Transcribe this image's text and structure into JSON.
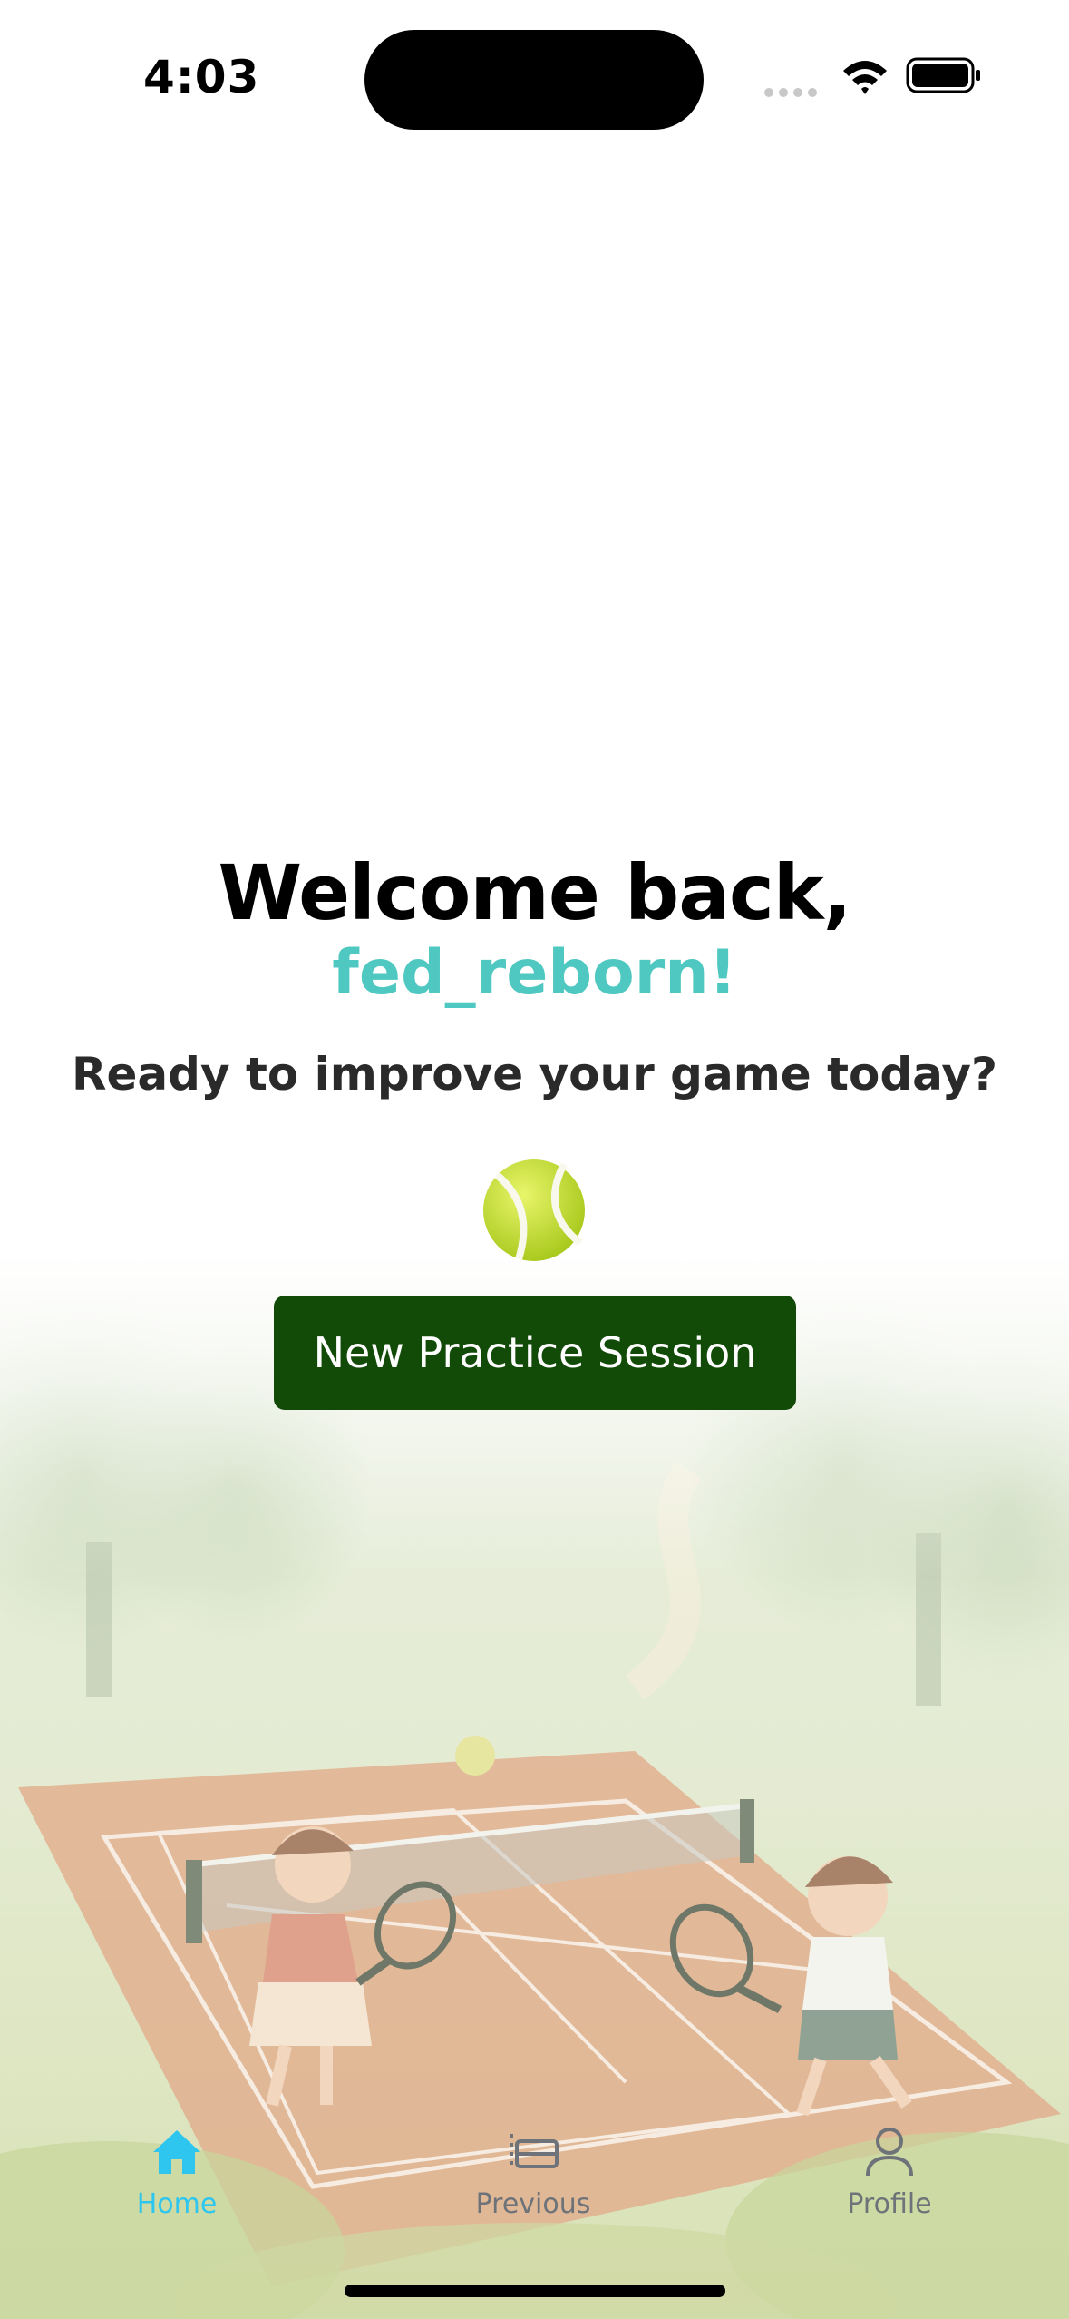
{
  "status_bar": {
    "time": "4:03",
    "icons": [
      "signal-icon",
      "wifi-icon",
      "battery-icon"
    ]
  },
  "main": {
    "welcome_title": "Welcome back,",
    "username": "fed_reborn!",
    "subtitle": "Ready to improve your game today?",
    "ball_icon": "tennis-ball-icon",
    "new_session_button": "New Practice Session"
  },
  "tab_bar": {
    "tabs": [
      {
        "label": "Home",
        "icon": "home-icon",
        "active": true
      },
      {
        "label": "Previous",
        "icon": "list-icon",
        "active": false
      },
      {
        "label": "Profile",
        "icon": "person-icon",
        "active": false
      }
    ]
  },
  "colors": {
    "accent": "#4ec8c0",
    "active_tab": "#2ec6ee",
    "inactive_tab": "#6d7378",
    "button_bg": "#124a08",
    "button_text": "#ffffff"
  }
}
